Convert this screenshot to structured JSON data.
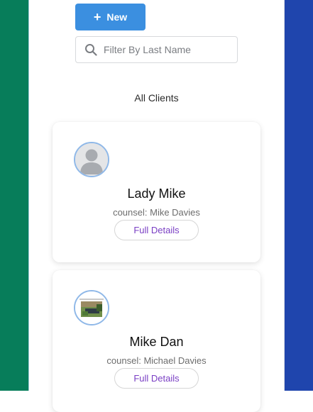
{
  "toolbar": {
    "new_label": "New",
    "new_icon": "plus-icon"
  },
  "search": {
    "placeholder": "Filter By Last Name",
    "value": "",
    "icon": "search-icon"
  },
  "section": {
    "title": "All Clients"
  },
  "clients": [
    {
      "name": "Lady Mike",
      "counsel": "counsel: Mike Davies",
      "details_label": "Full Details",
      "avatar": "default-avatar-icon"
    },
    {
      "name": "Mike Dan",
      "counsel": "counsel: Michael Davies",
      "details_label": "Full Details",
      "avatar": "photo-thumbnail"
    }
  ],
  "colors": {
    "left_band": "#077d5a",
    "right_band": "#1f45ad",
    "primary_button": "#3b8fe0",
    "details_text": "#7a3fc4",
    "avatar_ring": "#8fb8e8"
  }
}
